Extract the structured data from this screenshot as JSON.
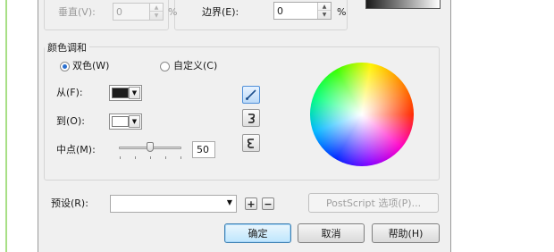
{
  "spacing": {
    "vertical_label": "垂直(V):",
    "vertical_value": "0",
    "vertical_unit": "%",
    "border_label": "边界(E):",
    "border_value": "0",
    "border_unit": "%"
  },
  "blend": {
    "group_title": "颜色调和",
    "two_color_label": "双色(W)",
    "custom_label": "自定义(C)",
    "from_label": "从(F):",
    "to_label": "到(O):",
    "midpoint_label": "中点(M):",
    "midpoint_value": "50",
    "midpoint_fraction": 0.5,
    "from_color": "#1e1e1e",
    "to_color": "#ffffff"
  },
  "icons": {
    "direct": "direct-blend-icon",
    "clockwise": "clockwise-blend-icon",
    "counterclockwise": "counterclockwise-blend-icon",
    "add": "add-preset-icon",
    "remove": "remove-preset-icon"
  },
  "preset": {
    "label": "预设(R):",
    "value": "",
    "postscript_label": "PostScript 选项(P)..."
  },
  "buttons": {
    "ok": "确定",
    "cancel": "取消",
    "help": "帮助(H)"
  },
  "colors": {
    "accent": "#3c7fb1",
    "window_bg": "#f0f0f0",
    "green_line": "#a8df86"
  }
}
